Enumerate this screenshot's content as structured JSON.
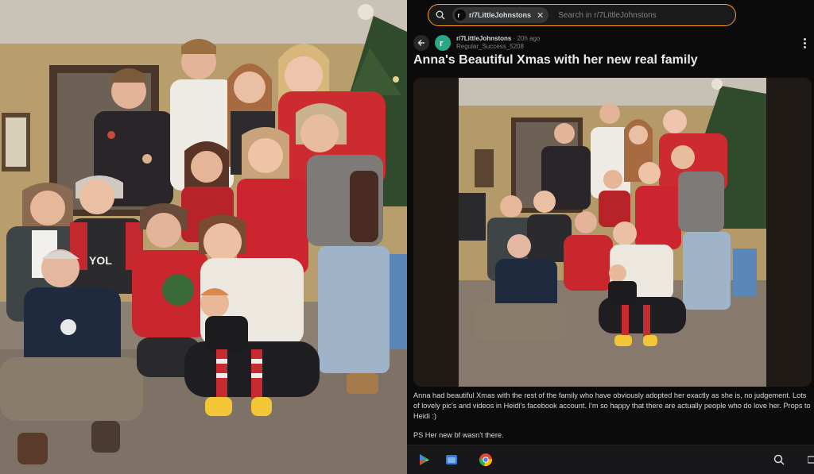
{
  "search": {
    "chip_label": "r/7LittleJohnstons",
    "placeholder": "Search in r/7LittleJohnstons"
  },
  "post": {
    "subreddit": "r/7LittleJohnstons",
    "age": "· 20h ago",
    "author": "Regular_Success_5208",
    "title": "Anna's Beautiful Xmas with her new real family",
    "body": "Anna had beautiful Xmas with the rest of the family who have obviously adopted her exactly as she is, no judgement. Lots of lovely pic's and videos in Heidi's facebook account. I'm so happy that there are actually people who do love her. Props to Heidi :)",
    "ps": "PS Her new bf wasn't there."
  },
  "photo": {
    "sweater_text": "YOL"
  },
  "taskbar": {
    "icons": [
      "play-store-icon",
      "files-icon",
      "chrome-icon",
      "search-icon",
      "screen-icon"
    ]
  },
  "colors": {
    "search_border": "#ff9f1a",
    "subreddit_avatar": "#2aa785",
    "background": "#0b0b0c"
  }
}
